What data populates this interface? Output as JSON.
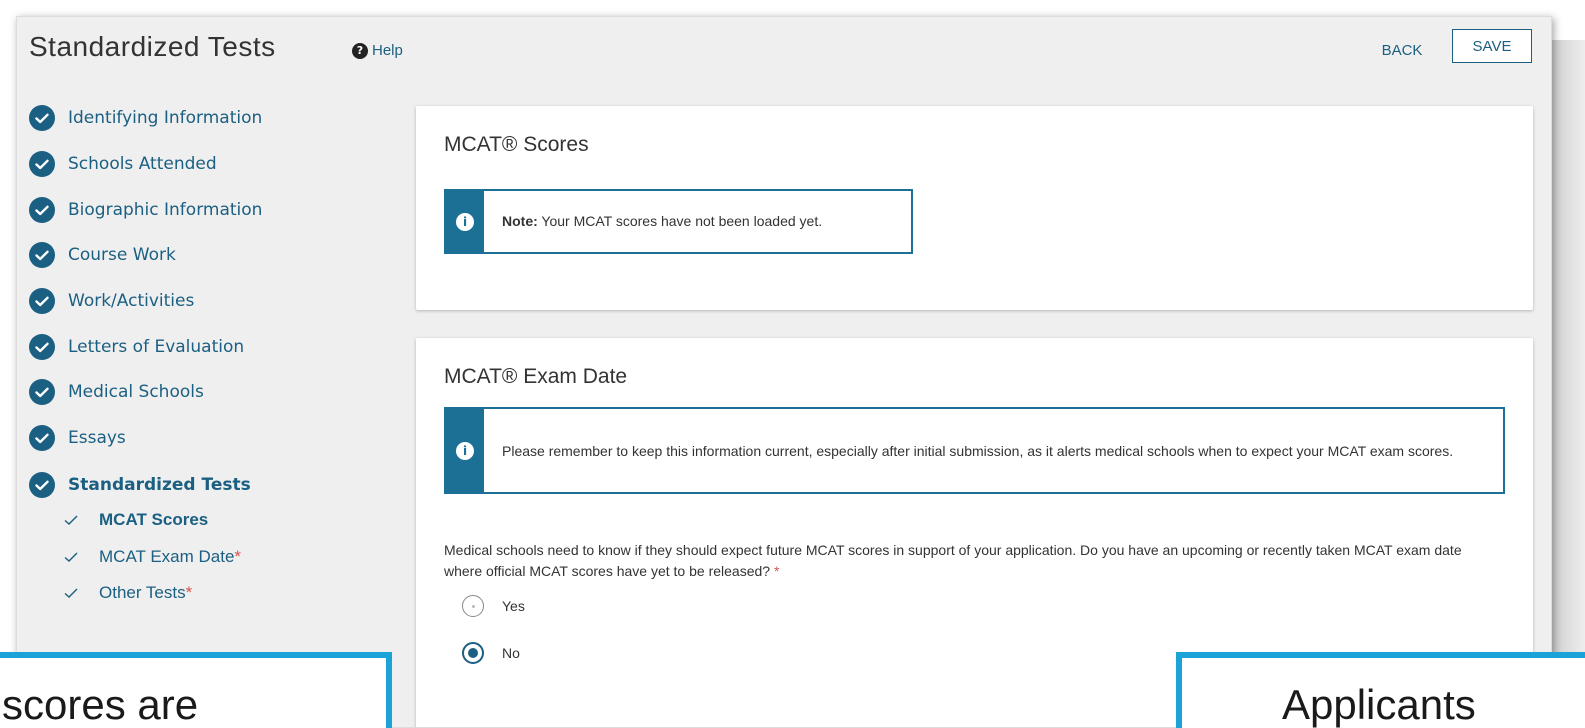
{
  "header": {
    "title": "Standardized Tests",
    "help_label": "Help",
    "back_label": "BACK",
    "save_label": "SAVE"
  },
  "sidebar": {
    "items": [
      {
        "label": "Identifying Information"
      },
      {
        "label": "Schools Attended"
      },
      {
        "label": "Biographic Information"
      },
      {
        "label": "Course Work"
      },
      {
        "label": "Work/Activities"
      },
      {
        "label": "Letters of Evaluation"
      },
      {
        "label": "Medical Schools"
      },
      {
        "label": "Essays"
      },
      {
        "label": "Standardized Tests",
        "active": true
      }
    ],
    "subitems": [
      {
        "label": "MCAT Scores",
        "required_mark": "",
        "active": true
      },
      {
        "label": "MCAT Exam Date",
        "required_mark": "*"
      },
      {
        "label": "Other Tests",
        "required_mark": "*"
      }
    ]
  },
  "scores_card": {
    "title": "MCAT® Scores",
    "note_label": "Note:",
    "note_text": " Your MCAT scores have not been loaded yet."
  },
  "exam_card": {
    "title": "MCAT® Exam Date",
    "alert_text": "Please remember to keep this information current, especially after initial submission, as it alerts medical schools when to expect your MCAT exam scores.",
    "question": "Medical schools need to know if they should expect future MCAT scores in support of your application. Do you have an upcoming or recently taken MCAT exam date where official MCAT scores have yet to be released?",
    "question_required_mark": " *",
    "options": [
      {
        "label": "Yes",
        "selected": false
      },
      {
        "label": "No",
        "selected": true
      }
    ]
  },
  "captions": {
    "left": "scores are",
    "right": "Applicants"
  },
  "colors": {
    "accent": "#1b5f82",
    "alert": "#1c6f95",
    "required": "#d9534f",
    "caption_border": "#19a3d8"
  }
}
